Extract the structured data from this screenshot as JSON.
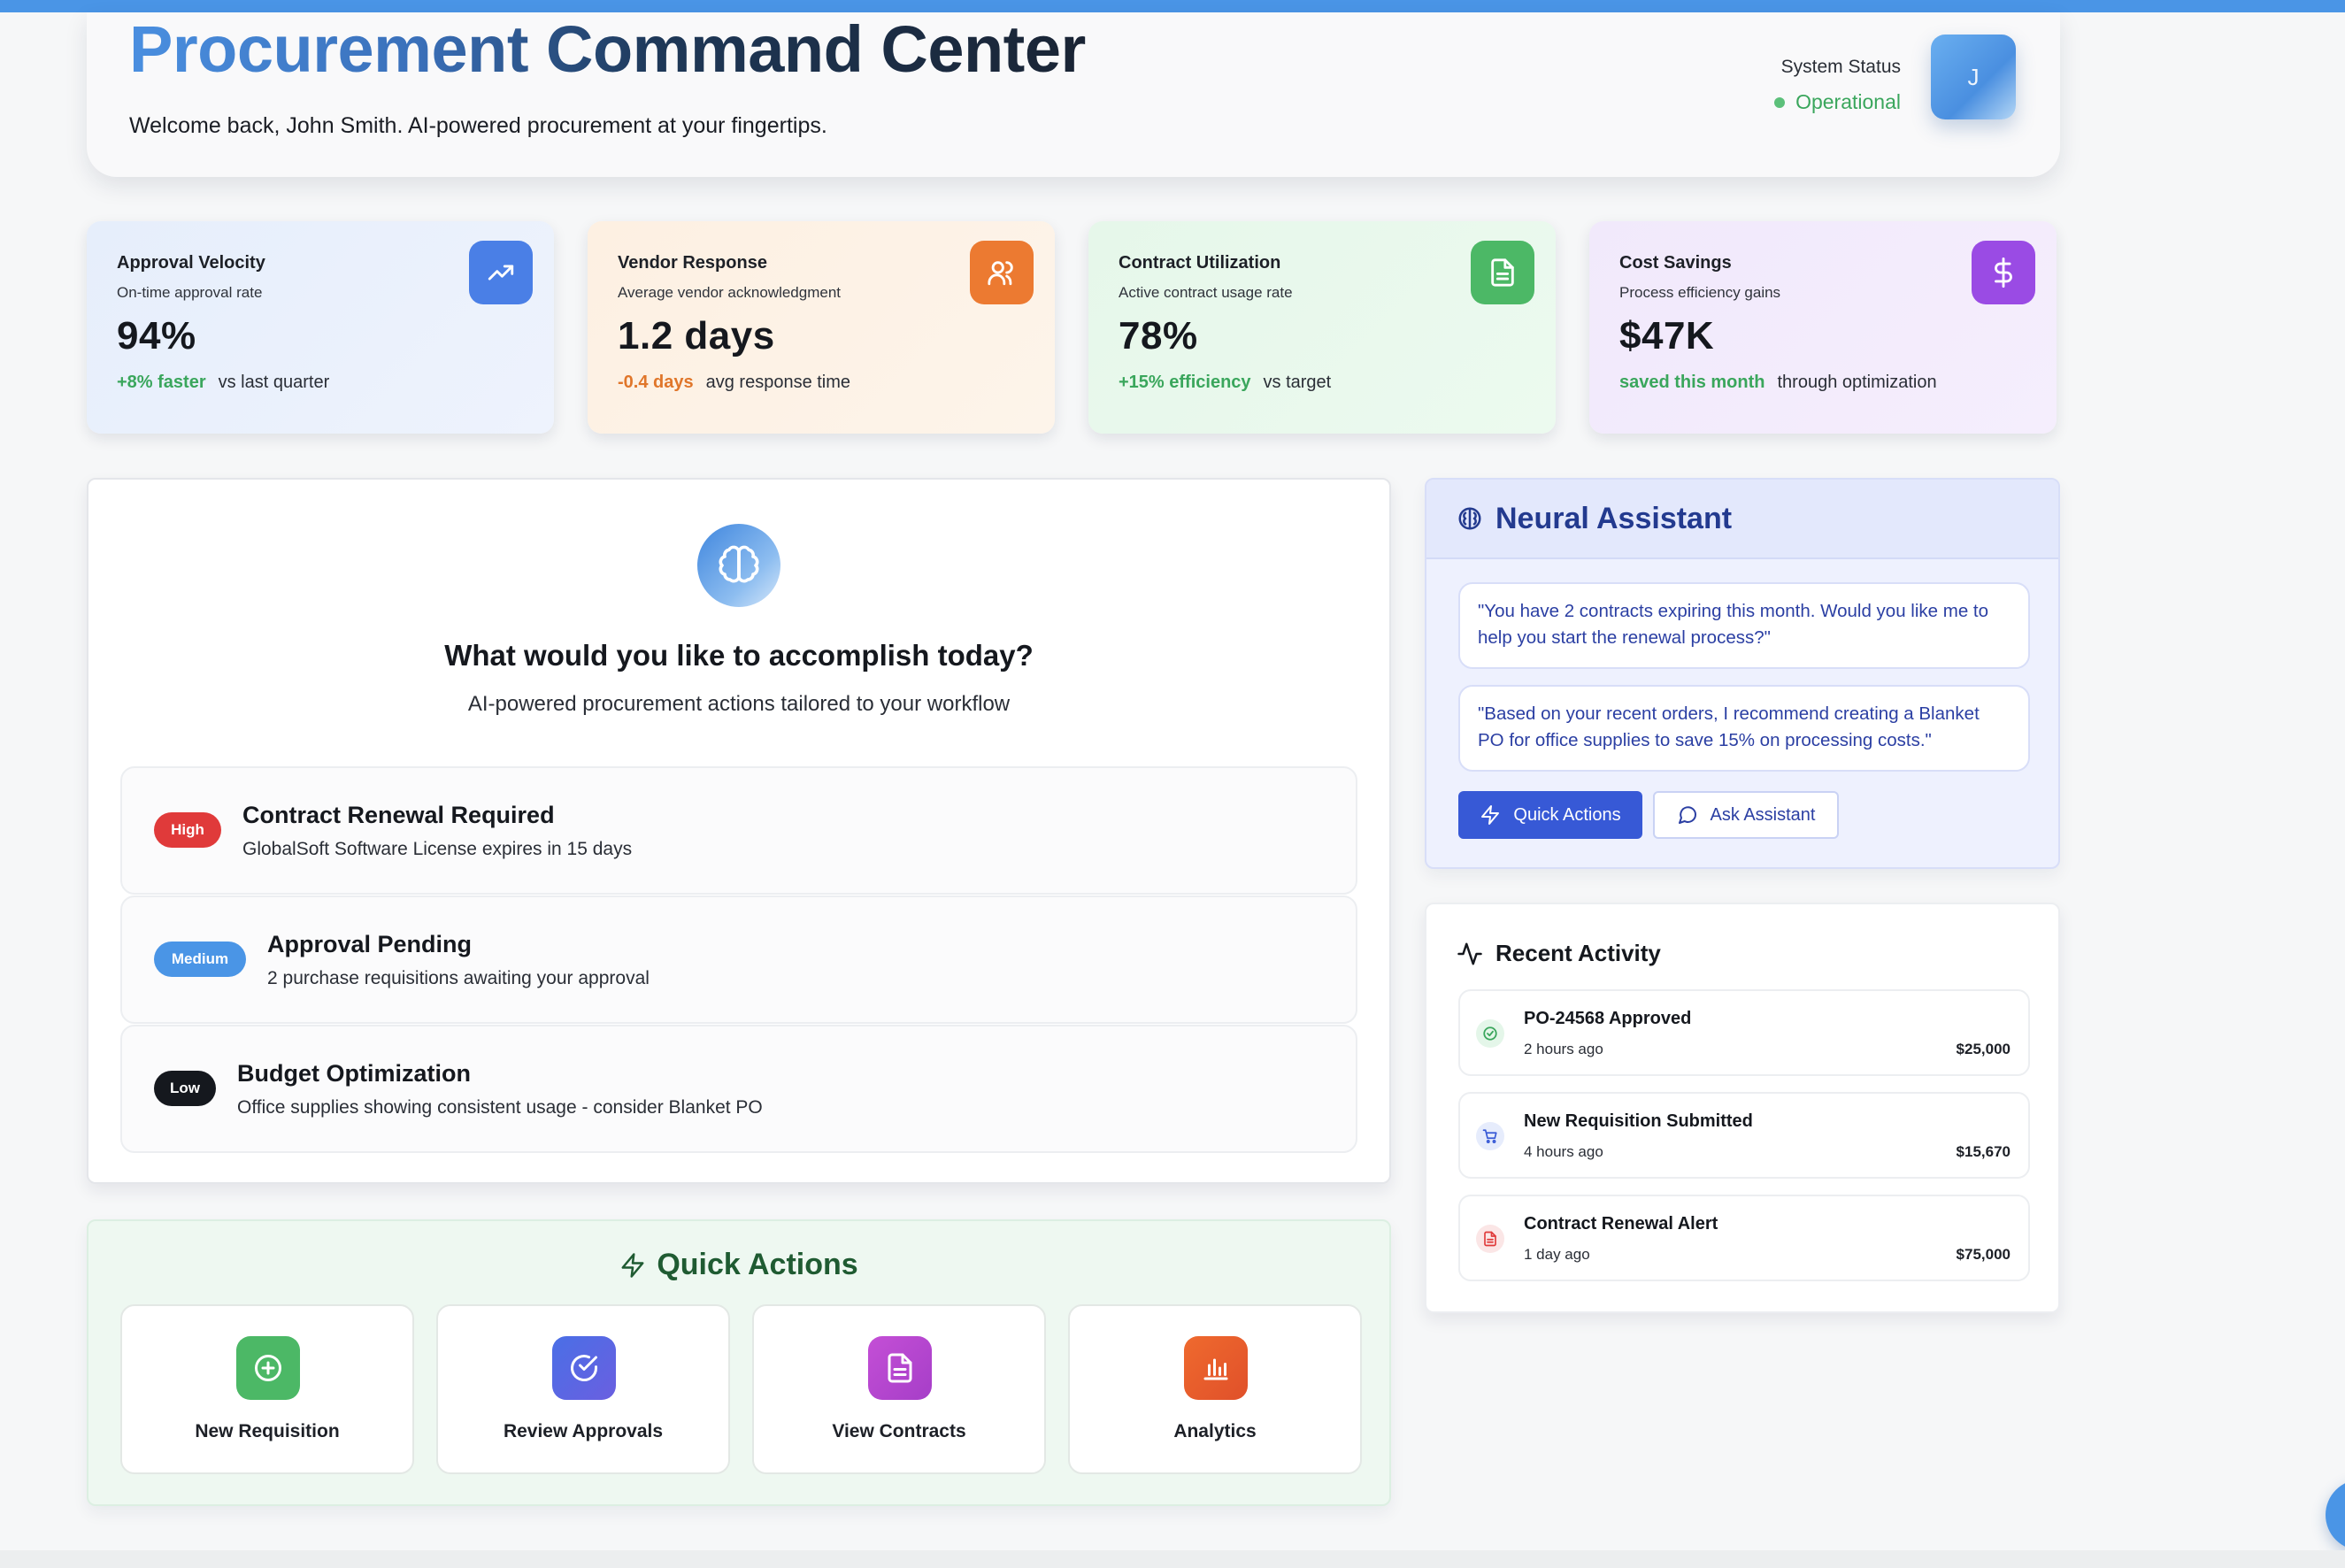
{
  "colors": {
    "accent": "#4a95e6",
    "status_green": "#3aa65c",
    "assistant_blue": "#3759d6",
    "priority_high": "#e03a3a",
    "priority_medium": "#4a95e6",
    "priority_low": "#15181e"
  },
  "header": {
    "title_part1": "Procurement",
    "title_part2": "Command Center",
    "welcome": "Welcome back, John Smith. AI-powered procurement at your fingertips.",
    "status_label": "System Status",
    "status_value": "Operational",
    "avatar_initial": "J"
  },
  "metrics": [
    {
      "title": "Approval Velocity",
      "subtitle": "On-time approval rate",
      "value": "94%",
      "delta": "+8% faster",
      "note": "vs last quarter",
      "icon": "trending-up-icon",
      "delta_color": "#3aa65c"
    },
    {
      "title": "Vendor Response",
      "subtitle": "Average vendor acknowledgment",
      "value": "1.2 days",
      "delta": "-0.4 days",
      "note": "avg response time",
      "icon": "users-icon",
      "delta_color": "#e0762a"
    },
    {
      "title": "Contract Utilization",
      "subtitle": "Active contract usage rate",
      "value": "78%",
      "delta": "+15% efficiency",
      "note": "vs target",
      "icon": "document-icon",
      "delta_color": "#3aa65c"
    },
    {
      "title": "Cost Savings",
      "subtitle": "Process efficiency gains",
      "value": "$47K",
      "delta": "saved this month",
      "note": "through optimization",
      "icon": "dollar-icon",
      "delta_color": "#3aa65c"
    }
  ],
  "accomplish": {
    "title": "What would you like to accomplish today?",
    "subtitle": "AI-powered procurement actions tailored to your workflow",
    "tasks": [
      {
        "priority": "High",
        "title": "Contract Renewal Required",
        "description": "GlobalSoft Software License expires in 15 days"
      },
      {
        "priority": "Medium",
        "title": "Approval Pending",
        "description": "2 purchase requisitions awaiting your approval"
      },
      {
        "priority": "Low",
        "title": "Budget Optimization",
        "description": "Office supplies showing consistent usage - consider Blanket PO"
      }
    ]
  },
  "quick_actions": {
    "heading": "Quick Actions",
    "items": [
      {
        "label": "New Requisition",
        "icon": "plus-circle-icon"
      },
      {
        "label": "Review Approvals",
        "icon": "check-circle-icon"
      },
      {
        "label": "View Contracts",
        "icon": "document-icon"
      },
      {
        "label": "Analytics",
        "icon": "bar-chart-icon"
      }
    ]
  },
  "assistant": {
    "title": "Neural Assistant",
    "messages": [
      "\"You have 2 contracts expiring this month. Would you like me to help you start the renewal process?\"",
      "\"Based on your recent orders, I recommend creating a Blanket PO for office supplies to save 15% on processing costs.\""
    ],
    "quick_actions_button": "Quick Actions",
    "ask_button": "Ask Assistant"
  },
  "activity": {
    "heading": "Recent Activity",
    "items": [
      {
        "title": "PO-24568 Approved",
        "time": "2 hours ago",
        "amount": "$25,000",
        "icon": "check-icon"
      },
      {
        "title": "New Requisition Submitted",
        "time": "4 hours ago",
        "amount": "$15,670",
        "icon": "cart-icon"
      },
      {
        "title": "Contract Renewal Alert",
        "time": "1 day ago",
        "amount": "$75,000",
        "icon": "document-icon"
      }
    ]
  }
}
